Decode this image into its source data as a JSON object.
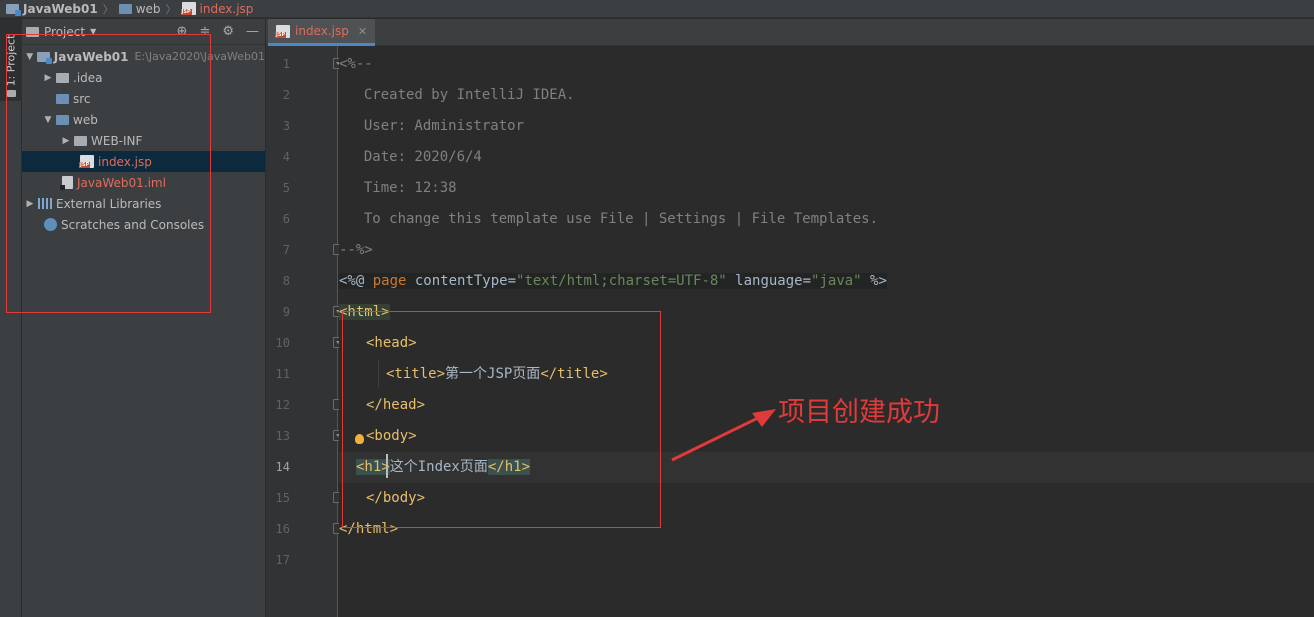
{
  "breadcrumb": [
    {
      "label": "JavaWeb01",
      "icon": "module-icon"
    },
    {
      "label": "web",
      "icon": "web-folder-icon"
    },
    {
      "label": "index.jsp",
      "icon": "jsp-file-icon"
    }
  ],
  "tool_strip": {
    "project_tab_label": "1: Project"
  },
  "project_panel": {
    "title": "Project",
    "root": {
      "label": "JavaWeb01",
      "path": "E:\\Java2020\\JavaWeb01"
    },
    "items": [
      {
        "label": ".idea"
      },
      {
        "label": "src"
      },
      {
        "label": "web"
      },
      {
        "label": "WEB-INF"
      },
      {
        "label": "index.jsp"
      },
      {
        "label": "JavaWeb01.iml"
      },
      {
        "label": "External Libraries"
      },
      {
        "label": "Scratches and Consoles"
      }
    ]
  },
  "editor": {
    "tab_title": "index.jsp",
    "line_numbers": [
      "1",
      "2",
      "3",
      "4",
      "5",
      "6",
      "7",
      "8",
      "9",
      "10",
      "11",
      "12",
      "13",
      "14",
      "15",
      "16",
      "17"
    ],
    "current_line": "14",
    "lines": {
      "l1": "<%--",
      "l2": "  Created by IntelliJ IDEA.",
      "l3": "  User: Administrator",
      "l4": "  Date: 2020/6/4",
      "l5": "  Time: 12:38",
      "l6": "  To change this template use File | Settings | File Templates.",
      "l7": "--%>",
      "l8_open": "<%@ ",
      "l8_page": "page",
      "l8_attr1": " contentType=",
      "l8_val1": "\"text/html;charset=UTF-8\"",
      "l8_attr2": " language=",
      "l8_val2": "\"java\"",
      "l8_close": " %>",
      "l9": "<html>",
      "l10": "<head>",
      "l11_open": "<title>",
      "l11_text": "第一个JSP页面",
      "l11_close": "</title>",
      "l12": "</head>",
      "l13": "<body>",
      "l14_open": "<h1>",
      "l14_text": "这个Index页面",
      "l14_close": "</h1>",
      "l15": "</body>",
      "l16": "</html>"
    }
  },
  "annotation": {
    "text": "项目创建成功",
    "color": "#e03a3a"
  },
  "colors": {
    "accent": "#4a88c7",
    "tag": "#e8bf6a",
    "string": "#6a8759",
    "comment": "#808080",
    "keyword": "#cc7832"
  }
}
